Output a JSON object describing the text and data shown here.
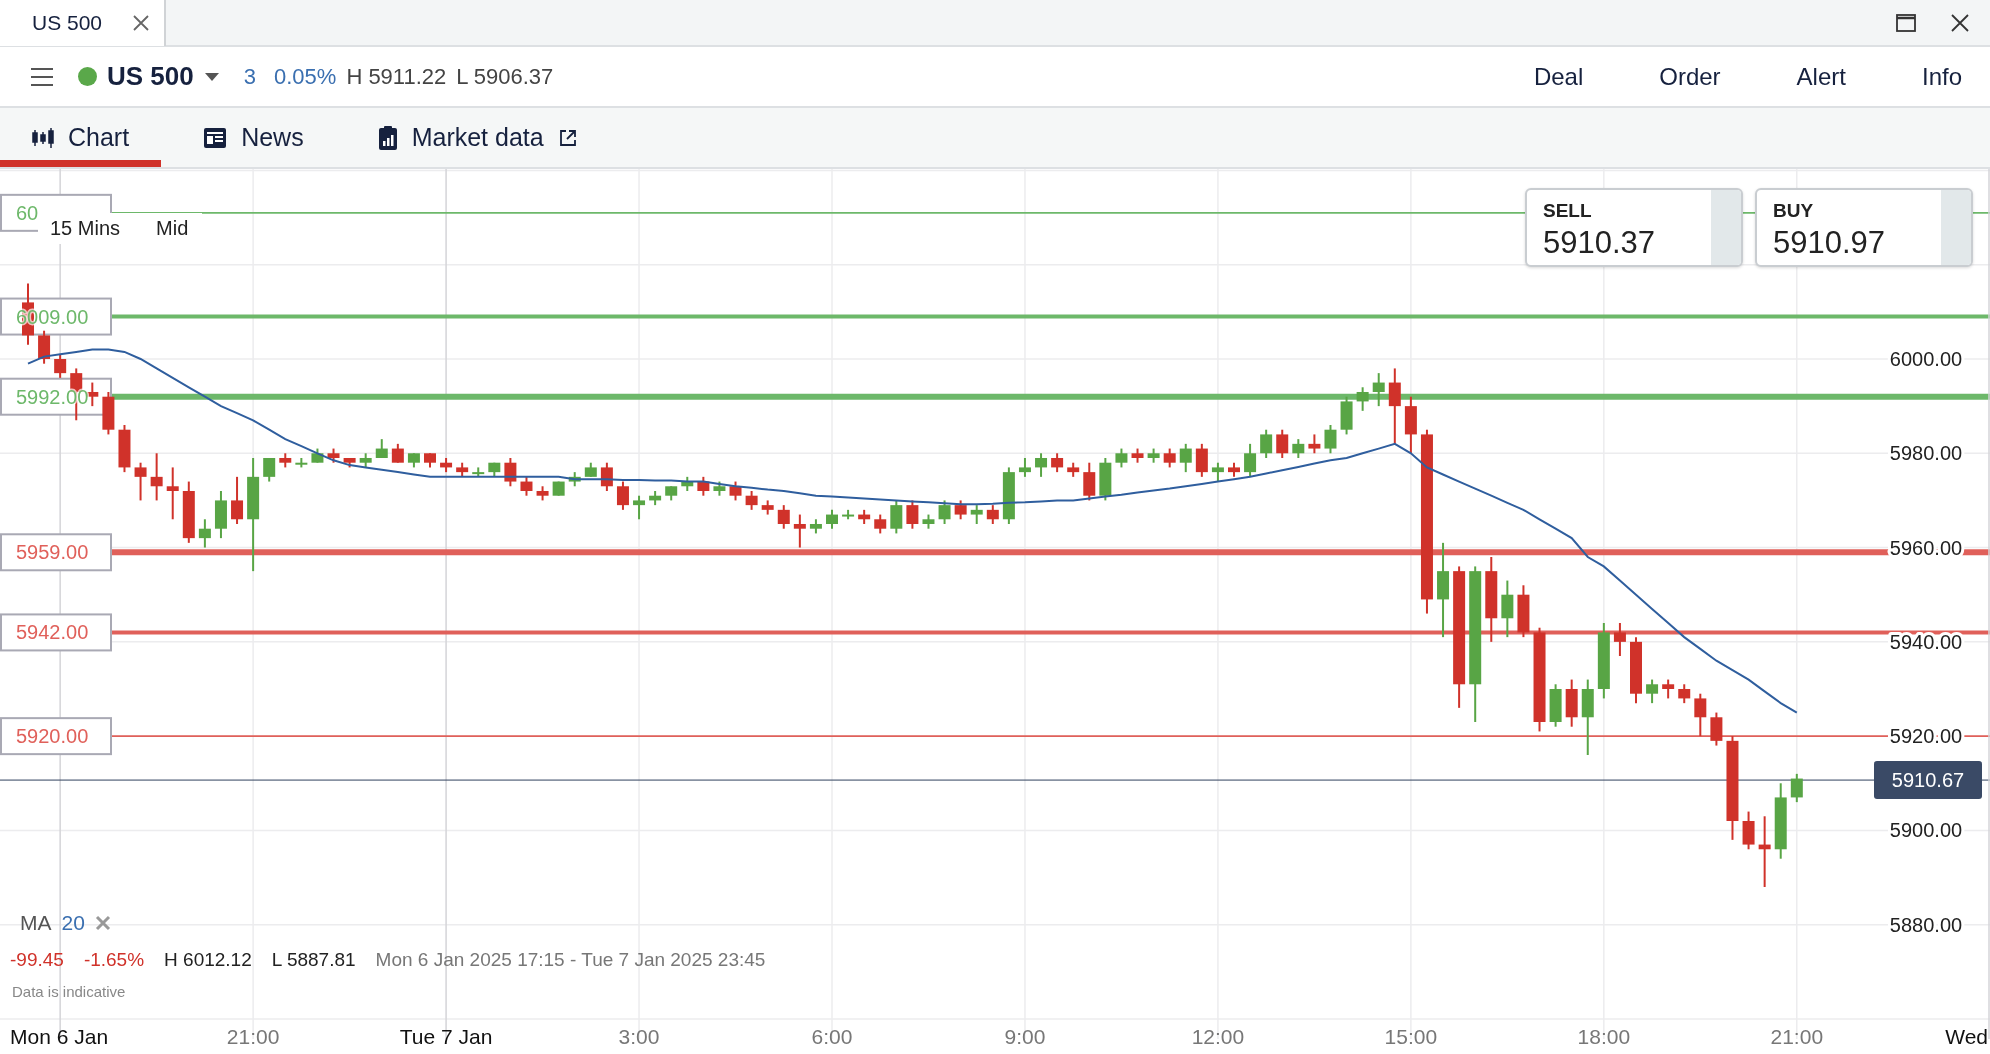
{
  "tab": {
    "title": "US 500"
  },
  "instrument": {
    "name": "US 500",
    "market_open": true,
    "change": "3",
    "change_pct": "0.05%",
    "high": "H 5911.22",
    "low": "L 5906.37"
  },
  "actions": [
    "Deal",
    "Order",
    "Alert",
    "Info"
  ],
  "nav_tabs": [
    {
      "label": "Chart",
      "kind": "chart",
      "selected": true
    },
    {
      "label": "News",
      "kind": "news",
      "selected": false
    },
    {
      "label": "Market data",
      "kind": "market_data",
      "selected": false
    }
  ],
  "chart": {
    "interval": "15 Mins",
    "price_type": "Mid",
    "sell": {
      "label": "SELL",
      "price": "5910.37"
    },
    "buy": {
      "label": "BUY",
      "price": "5910.97"
    },
    "indicator": {
      "period": "20"
    },
    "stats": {
      "change": "-99.45",
      "change_pct": "-1.65%",
      "high": "H 6012.12",
      "low": "L 5887.81",
      "range": "Mon 6 Jan 2025 17:15 - Tue 7 Jan 2025 23:45"
    },
    "disclaimer": "Data is indicative",
    "next_day_label": "Wed",
    "covered_level_label": "60",
    "chart_data": {
      "type": "candlestick",
      "grid": true,
      "ylim": [
        5860,
        6040.3
      ],
      "categories": [
        null,
        null,
        "Mon 6 Jan",
        null,
        null,
        null,
        null,
        null,
        null,
        null,
        null,
        null,
        null,
        null,
        "21:00",
        null,
        null,
        null,
        null,
        null,
        null,
        null,
        null,
        null,
        null,
        null,
        "Tue 7 Jan",
        null,
        null,
        null,
        null,
        null,
        null,
        null,
        null,
        null,
        null,
        null,
        "3:00",
        null,
        null,
        null,
        null,
        null,
        null,
        null,
        null,
        null,
        null,
        null,
        "6:00",
        null,
        null,
        null,
        null,
        null,
        null,
        null,
        null,
        null,
        null,
        null,
        "9:00",
        null,
        null,
        null,
        null,
        null,
        null,
        null,
        null,
        null,
        null,
        null,
        "12:00",
        null,
        null,
        null,
        null,
        null,
        null,
        null,
        null,
        null,
        null,
        null,
        "15:00",
        null,
        null,
        null,
        null,
        null,
        null,
        null,
        null,
        null,
        null,
        null,
        "18:00",
        null,
        null,
        null,
        null,
        null,
        null,
        null,
        null,
        null,
        null,
        null,
        "21:00"
      ],
      "yticks": [
        {
          "value": 5880,
          "label": "5880.00"
        },
        {
          "value": 5900,
          "label": "5900.00"
        },
        {
          "value": 5920,
          "label": "5920.00"
        },
        {
          "value": 5940,
          "label": "5940.00"
        },
        {
          "value": 5960,
          "label": "5960.00"
        },
        {
          "value": 5980,
          "label": "5980.00"
        },
        {
          "value": 6000,
          "label": "6000.00"
        }
      ],
      "ref_lines": [
        {
          "axis": "y",
          "value": 6031,
          "color": "#6db86a"
        },
        {
          "axis": "y",
          "value": 6009,
          "label": "6009.00",
          "color": "#6db86a"
        },
        {
          "axis": "y",
          "value": 5992,
          "label": "5992.00",
          "color": "#6db86a"
        },
        {
          "axis": "y",
          "value": 5959,
          "label": "5959.00",
          "color": "#e0605a"
        },
        {
          "axis": "y",
          "value": 5942,
          "label": "5942.00",
          "color": "#e0605a"
        },
        {
          "axis": "y",
          "value": 5920,
          "label": "5920.00",
          "color": "#e0605a"
        },
        {
          "axis": "y",
          "value": 5910.67,
          "label": "5910.67",
          "color": "#3a4a66"
        }
      ],
      "series": [
        {
          "ohlc": [
            [
              6012,
              6016,
              6003,
              6005
            ],
            [
              6005,
              6006,
              5999,
              6000
            ],
            [
              6000,
              6001,
              5996,
              5997
            ],
            [
              5997,
              5998,
              5987,
              5993
            ],
            [
              5993,
              5995,
              5990,
              5992
            ],
            [
              5992,
              5993,
              5984,
              5985
            ],
            [
              5985,
              5986,
              5976,
              5977
            ],
            [
              5977,
              5978,
              5970,
              5975
            ],
            [
              5975,
              5980,
              5970,
              5973
            ],
            [
              5973,
              5977,
              5966,
              5972
            ],
            [
              5972,
              5974,
              5961,
              5962
            ],
            [
              5962,
              5966,
              5960,
              5964
            ],
            [
              5964,
              5972,
              5962,
              5970
            ],
            [
              5970,
              5975,
              5965,
              5966
            ],
            [
              5966,
              5979,
              5955,
              5975
            ],
            [
              5975,
              5979,
              5974,
              5979
            ],
            [
              5979,
              5980,
              5977,
              5978
            ],
            [
              5978,
              5979,
              5977,
              5978
            ],
            [
              5978,
              5981,
              5978,
              5980
            ],
            [
              5980,
              5981,
              5978,
              5979
            ],
            [
              5979,
              5979,
              5977,
              5978
            ],
            [
              5978,
              5980,
              5977,
              5979
            ],
            [
              5979,
              5983,
              5979,
              5981
            ],
            [
              5981,
              5982,
              5978,
              5978
            ],
            [
              5978,
              5980,
              5977,
              5980
            ],
            [
              5980,
              5980,
              5977,
              5978
            ],
            [
              5978,
              5979,
              5976,
              5977
            ],
            [
              5977,
              5978,
              5975,
              5976
            ],
            [
              5976,
              5977,
              5975,
              5976
            ],
            [
              5976,
              5978,
              5975,
              5978
            ],
            [
              5978,
              5979,
              5973,
              5974
            ],
            [
              5974,
              5975,
              5971,
              5972
            ],
            [
              5972,
              5973,
              5970,
              5971
            ],
            [
              5971,
              5974,
              5971,
              5974
            ],
            [
              5974,
              5976,
              5973,
              5975
            ],
            [
              5975,
              5978,
              5975,
              5977
            ],
            [
              5977,
              5978,
              5972,
              5973
            ],
            [
              5973,
              5974,
              5968,
              5969
            ],
            [
              5969,
              5971,
              5966,
              5970
            ],
            [
              5970,
              5972,
              5969,
              5971
            ],
            [
              5971,
              5973,
              5970,
              5973
            ],
            [
              5973,
              5975,
              5972,
              5974
            ],
            [
              5974,
              5975,
              5971,
              5972
            ],
            [
              5972,
              5974,
              5971,
              5973
            ],
            [
              5973,
              5974,
              5970,
              5971
            ],
            [
              5971,
              5972,
              5968,
              5969
            ],
            [
              5969,
              5970,
              5967,
              5968
            ],
            [
              5968,
              5969,
              5964,
              5965
            ],
            [
              5965,
              5967,
              5960,
              5964
            ],
            [
              5964,
              5966,
              5963,
              5965
            ],
            [
              5965,
              5968,
              5964,
              5967
            ],
            [
              5967,
              5968,
              5966,
              5967
            ],
            [
              5967,
              5968,
              5965,
              5966
            ],
            [
              5966,
              5967,
              5963,
              5964
            ],
            [
              5964,
              5970,
              5963,
              5969
            ],
            [
              5969,
              5970,
              5964,
              5965
            ],
            [
              5965,
              5967,
              5964,
              5966
            ],
            [
              5966,
              5970,
              5965,
              5969
            ],
            [
              5969,
              5970,
              5966,
              5967
            ],
            [
              5967,
              5969,
              5965,
              5968
            ],
            [
              5968,
              5969,
              5965,
              5966
            ],
            [
              5966,
              5977,
              5965,
              5976
            ],
            [
              5976,
              5979,
              5975,
              5977
            ],
            [
              5977,
              5980,
              5975,
              5979
            ],
            [
              5979,
              5980,
              5976,
              5977
            ],
            [
              5977,
              5978,
              5975,
              5976
            ],
            [
              5976,
              5978,
              5970,
              5971
            ],
            [
              5971,
              5979,
              5970,
              5978
            ],
            [
              5978,
              5981,
              5977,
              5980
            ],
            [
              5980,
              5981,
              5978,
              5979
            ],
            [
              5979,
              5981,
              5978,
              5980
            ],
            [
              5980,
              5981,
              5977,
              5978
            ],
            [
              5978,
              5982,
              5976,
              5981
            ],
            [
              5981,
              5982,
              5975,
              5976
            ],
            [
              5976,
              5978,
              5974,
              5977
            ],
            [
              5977,
              5978,
              5975,
              5976
            ],
            [
              5976,
              5982,
              5975,
              5980
            ],
            [
              5980,
              5985,
              5979,
              5984
            ],
            [
              5984,
              5985,
              5979,
              5980
            ],
            [
              5980,
              5983,
              5979,
              5982
            ],
            [
              5982,
              5984,
              5980,
              5981
            ],
            [
              5981,
              5986,
              5980,
              5985
            ],
            [
              5985,
              5992,
              5984,
              5991
            ],
            [
              5991,
              5994,
              5989,
              5993
            ],
            [
              5993,
              5997,
              5990,
              5995
            ],
            [
              5995,
              5998,
              5982,
              5990
            ],
            [
              5990,
              5992,
              5980,
              5984
            ],
            [
              5984,
              5985,
              5946,
              5949
            ],
            [
              5949,
              5961,
              5941,
              5955
            ],
            [
              5955,
              5956,
              5926,
              5931
            ],
            [
              5931,
              5956,
              5923,
              5955
            ],
            [
              5955,
              5958,
              5940,
              5945
            ],
            [
              5945,
              5953,
              5941,
              5950
            ],
            [
              5950,
              5952,
              5941,
              5942
            ],
            [
              5942,
              5943,
              5921,
              5923
            ],
            [
              5923,
              5931,
              5922,
              5930
            ],
            [
              5930,
              5932,
              5922,
              5924
            ],
            [
              5924,
              5932,
              5916,
              5930
            ],
            [
              5930,
              5944,
              5928,
              5942
            ],
            [
              5942,
              5944,
              5937,
              5940
            ],
            [
              5940,
              5941,
              5927,
              5929
            ],
            [
              5929,
              5932,
              5927,
              5931
            ],
            [
              5931,
              5932,
              5928,
              5930
            ],
            [
              5930,
              5931,
              5927,
              5928
            ],
            [
              5928,
              5929,
              5920,
              5924
            ],
            [
              5924,
              5925,
              5918,
              5919
            ],
            [
              5919,
              5920,
              5898,
              5902
            ],
            [
              5902,
              5904,
              5896,
              5897
            ],
            [
              5897,
              5903,
              5888,
              5896
            ],
            [
              5896,
              5910,
              5894,
              5907
            ],
            [
              5907,
              5912,
              5906,
              5911
            ]
          ]
        },
        {
          "name": "MA",
          "type": "line",
          "color": "#2f5e9e",
          "values": [
            5999,
            6000.5,
            6001,
            6001.5,
            6002,
            6002,
            6001.5,
            6000,
            5998,
            5996,
            5994,
            5992,
            5990,
            5988.5,
            5987,
            5985,
            5983,
            5981.5,
            5980,
            5978.5,
            5977.5,
            5977,
            5976.5,
            5976,
            5975.5,
            5975,
            5975,
            5975,
            5975,
            5975,
            5975,
            5975,
            5975,
            5975,
            5974.5,
            5974.5,
            5974.5,
            5974.3,
            5974.3,
            5974.2,
            5974.2,
            5974,
            5974,
            5973.5,
            5973,
            5972.7,
            5972.3,
            5972,
            5971.5,
            5971,
            5970.8,
            5970.6,
            5970.4,
            5970.2,
            5970,
            5969.8,
            5969.6,
            5969.4,
            5969.2,
            5969.2,
            5969.3,
            5969.5,
            5969.6,
            5969.8,
            5970,
            5970,
            5970.4,
            5970.8,
            5971.2,
            5971.7,
            5972.1,
            5972.5,
            5973,
            5973.5,
            5974,
            5974.5,
            5975,
            5975.7,
            5976.4,
            5977.1,
            5977.8,
            5978.5,
            5979,
            5980,
            5981,
            5982,
            5980,
            5977,
            5975.5,
            5974,
            5972.5,
            5971,
            5969.5,
            5968,
            5966,
            5964,
            5962,
            5958,
            5956,
            5953,
            5950,
            5947,
            5944,
            5941,
            5938.5,
            5936,
            5934,
            5932,
            5929.5,
            5927,
            5925
          ]
        }
      ]
    }
  }
}
